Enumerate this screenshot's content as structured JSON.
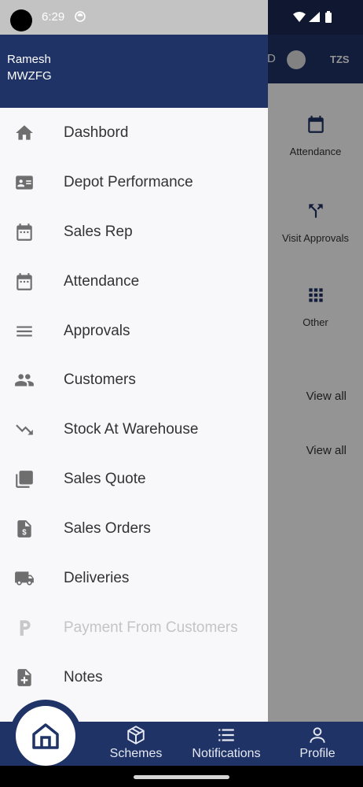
{
  "status_bar": {
    "time": "6:29"
  },
  "background_app": {
    "header": {
      "toggle_text": "D",
      "currency": "TZS"
    },
    "tiles": [
      {
        "label": "Attendance",
        "icon": "calendar-icon"
      },
      {
        "label": "Visit Approvals",
        "icon": "merge-arrow-icon"
      },
      {
        "label": "Other",
        "icon": "grid-icon"
      }
    ],
    "view_all_1": "View all",
    "view_all_2": "View all"
  },
  "drawer": {
    "user_name": "Ramesh",
    "user_code": "MWZFG",
    "items": [
      {
        "label": "Dashbord",
        "icon": "home-icon"
      },
      {
        "label": "Depot Performance",
        "icon": "id-card-icon"
      },
      {
        "label": "Sales Rep",
        "icon": "calendar-icon"
      },
      {
        "label": "Attendance",
        "icon": "calendar-icon"
      },
      {
        "label": "Approvals",
        "icon": "menu-lines-icon"
      },
      {
        "label": "Customers",
        "icon": "people-icon"
      },
      {
        "label": "Stock At Warehouse",
        "icon": "trend-down-icon"
      },
      {
        "label": "Sales Quote",
        "icon": "copy-icon"
      },
      {
        "label": "Sales Orders",
        "icon": "invoice-dollar-icon"
      },
      {
        "label": "Deliveries",
        "icon": "truck-icon"
      },
      {
        "label": "Payment From Customers",
        "icon": "parking-p-icon",
        "disabled": true
      },
      {
        "label": "Notes",
        "icon": "note-add-icon"
      }
    ]
  },
  "bottom_nav": {
    "items": [
      {
        "label": "Schemes",
        "icon": "cube-icon"
      },
      {
        "label": "Notifications",
        "icon": "list-icon"
      },
      {
        "label": "Profile",
        "icon": "user-icon"
      }
    ],
    "home_icon": "home-icon"
  },
  "colors": {
    "primary": "#1f3366",
    "drawer_bg": "#f8f8fa",
    "icon_gray": "#6e6e6e",
    "disabled_text": "#c4c4c4"
  }
}
